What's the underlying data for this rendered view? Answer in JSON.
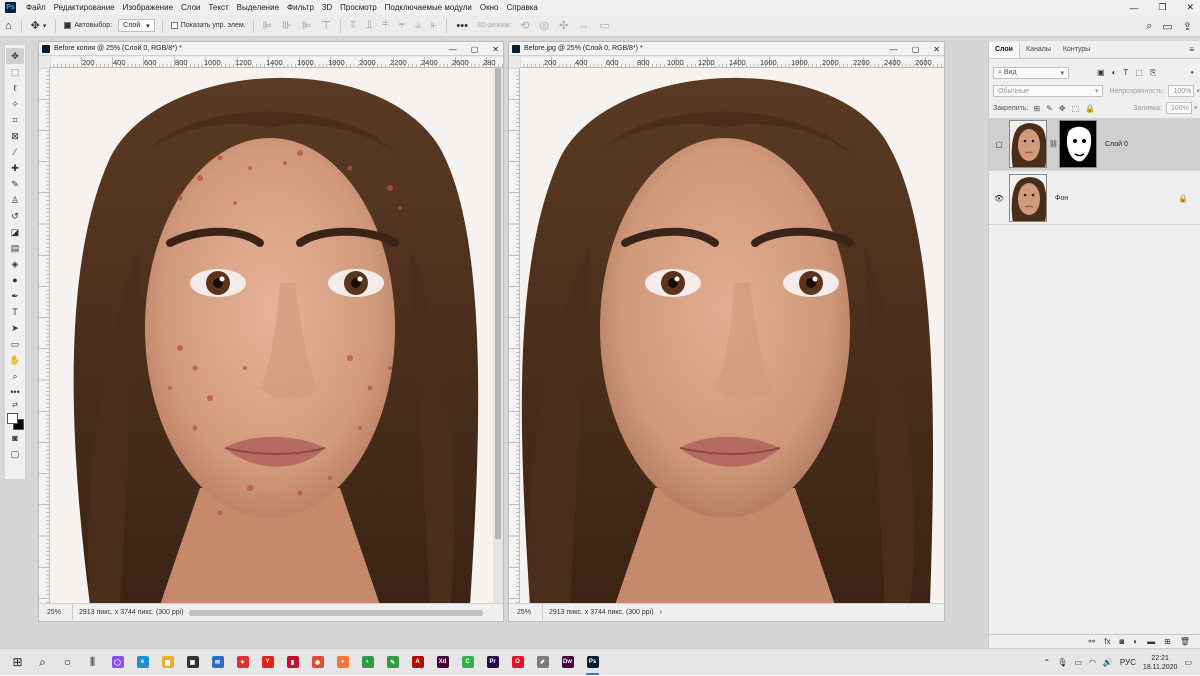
{
  "app": {
    "logo": "Ps",
    "menu": [
      "Файл",
      "Редактирование",
      "Изображение",
      "Слои",
      "Текст",
      "Выделение",
      "Фильтр",
      "3D",
      "Просмотр",
      "Подключаемые модули",
      "Окно",
      "Справка"
    ],
    "window_controls": [
      "—",
      "❐",
      "✕"
    ]
  },
  "options": {
    "autoselect_label": "Автовыбор:",
    "autoselect_checked": true,
    "autoselect_target": "Слой",
    "show_transform_label": "Показать упр. элем.",
    "mode_3d_label": "3D-режим:"
  },
  "documents": [
    {
      "title": "Before копия @ 25% (Слой 0, RGB/8*) *",
      "zoom": "25%",
      "info": "2913 пикс. x 3744 пикс. (300 ppi)",
      "ruler": [
        "200",
        "400",
        "600",
        "800",
        "1000",
        "1200",
        "1400",
        "1600",
        "1800",
        "2000",
        "2200",
        "2400",
        "2600",
        "280"
      ],
      "skin_tone": "#d9a184",
      "blemishes": true
    },
    {
      "title": "Before.jpg @ 25% (Слой 0, RGB/8*) *",
      "zoom": "25%",
      "info": "2913 пикс. x 3744 пикс. (300 ppi)",
      "ruler": [
        "200",
        "400",
        "600",
        "800",
        "1000",
        "1200",
        "1400",
        "1600",
        "1800",
        "2000",
        "2200",
        "2400",
        "2600"
      ],
      "skin_tone": "#d9a084",
      "blemishes": false
    }
  ],
  "layers_panel": {
    "tabs": [
      "Слои",
      "Каналы",
      "Контуры"
    ],
    "active_tab": "Слои",
    "filter_kind": "Вид",
    "blend_mode": "Обычные",
    "opacity_label": "Непрозрачность:",
    "opacity_value": "100%",
    "lock_label": "Закрепить:",
    "fill_label": "Заливка:",
    "fill_value": "100%",
    "layers": [
      {
        "name": "Слой 0",
        "visible": false,
        "has_mask": true,
        "selected": true,
        "locked": false
      },
      {
        "name": "Фон",
        "visible": true,
        "has_mask": false,
        "selected": false,
        "locked": true
      }
    ]
  },
  "taskbar": {
    "apps": [
      {
        "name": "start",
        "glyph": "⊞",
        "color": "#222222"
      },
      {
        "name": "search",
        "glyph": "⌕",
        "color": "#222222"
      },
      {
        "name": "task-view",
        "glyph": "○",
        "color": "#222222"
      },
      {
        "name": "widgets",
        "glyph": "⫴",
        "color": "#222222"
      },
      {
        "name": "alice",
        "glyph": "◯",
        "color": "#8a4dff"
      },
      {
        "name": "edge",
        "glyph": "e",
        "color": "#1f8fd6"
      },
      {
        "name": "explorer",
        "glyph": "▆",
        "color": "#e8b030"
      },
      {
        "name": "store",
        "glyph": "▣",
        "color": "#333333"
      },
      {
        "name": "mail",
        "glyph": "✉",
        "color": "#2a6fc9"
      },
      {
        "name": "gift",
        "glyph": "✦",
        "color": "#d9352b"
      },
      {
        "name": "yandex",
        "glyph": "Y",
        "color": "#e0221b"
      },
      {
        "name": "acrobat-reader",
        "glyph": "▮",
        "color": "#c3102c"
      },
      {
        "name": "chrome",
        "glyph": "◉",
        "color": "#dd4b39"
      },
      {
        "name": "firefox",
        "glyph": "●",
        "color": "#ff7139"
      },
      {
        "name": "photos",
        "glyph": "◐",
        "color": "#2e9b46"
      },
      {
        "name": "notes",
        "glyph": "✎",
        "color": "#2f9e3c"
      },
      {
        "name": "acrobat",
        "glyph": "A",
        "color": "#b30b00"
      },
      {
        "name": "xd",
        "glyph": "Xd",
        "color": "#470137"
      },
      {
        "name": "camtasia",
        "glyph": "C",
        "color": "#36b24a"
      },
      {
        "name": "premiere",
        "glyph": "Pr",
        "color": "#2a0a4f"
      },
      {
        "name": "opera",
        "glyph": "O",
        "color": "#e8102b"
      },
      {
        "name": "paint",
        "glyph": "✐",
        "color": "#7a7a7a"
      },
      {
        "name": "dreamweaver",
        "glyph": "Dw",
        "color": "#470137"
      },
      {
        "name": "photoshop",
        "glyph": "Ps",
        "color": "#001e36"
      }
    ],
    "language": "РУС",
    "time": "22:21",
    "date": "18.11.2020"
  }
}
